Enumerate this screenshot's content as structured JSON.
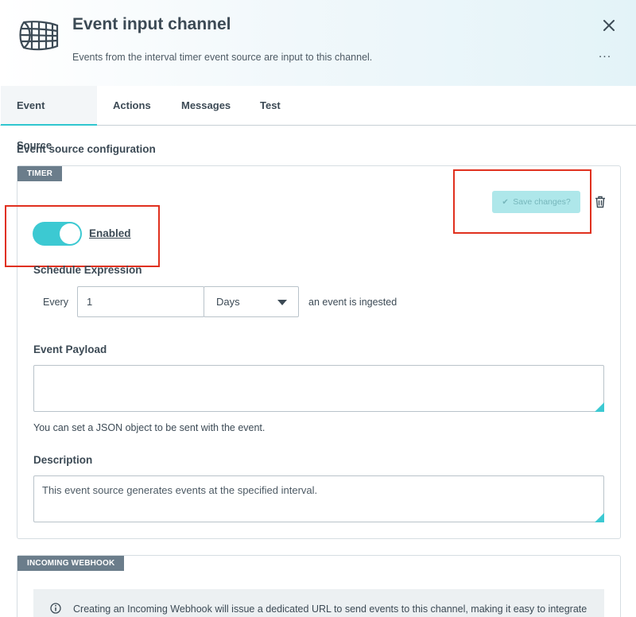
{
  "header": {
    "title": "Event input channel",
    "subtitle": "Events from the interval timer event source are input to this channel.",
    "more_label": "..."
  },
  "tabs": [
    {
      "label": "Event Source",
      "active": true
    },
    {
      "label": "Actions",
      "active": false
    },
    {
      "label": "Messages",
      "active": false
    },
    {
      "label": "Test",
      "active": false
    }
  ],
  "section_title": "Event source configuration",
  "timer_card": {
    "tag": "TIMER",
    "save_button": "Save changes?",
    "toggle": {
      "label": "Enabled",
      "on": true
    },
    "schedule": {
      "heading": "Schedule Expression",
      "prefix": "Every",
      "value": "1",
      "unit": "Days",
      "suffix": "an event is ingested"
    },
    "payload": {
      "heading": "Event Payload",
      "value": "",
      "hint": "You can set a JSON object to be sent with the event."
    },
    "description": {
      "heading": "Description",
      "value": "This event source generates events at the specified interval."
    }
  },
  "webhook_card": {
    "tag": "INCOMING WEBHOOK",
    "info": "Creating an Incoming Webhook will issue a dedicated URL to send events to this channel, making it easy to integrate"
  },
  "colors": {
    "accent": "#3cc9d2",
    "highlight": "#e0301e",
    "tag_bg": "#6b7d8b"
  }
}
